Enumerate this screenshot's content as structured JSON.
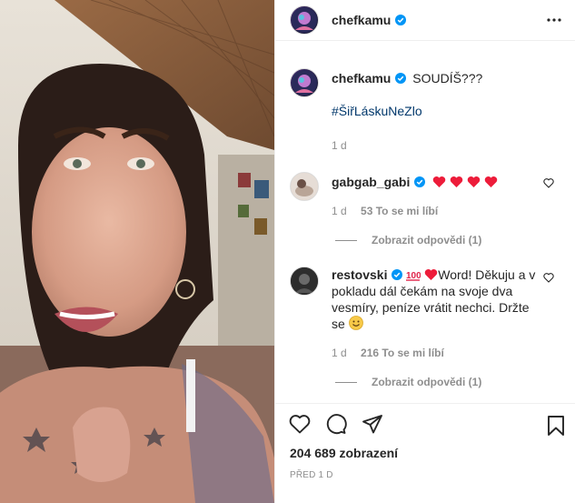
{
  "post": {
    "username": "chefkamu",
    "caption": "SOUDÍŠ???",
    "hashtag": "#ŠiřLáskuNeZlo",
    "caption_age": "1 d"
  },
  "comments": [
    {
      "username": "gabgab_gabi",
      "text": "",
      "emojis": [
        "red-heart",
        "red-heart",
        "red-heart",
        "red-heart"
      ],
      "age": "1 d",
      "likes": "53 To se mi líbí",
      "replies_label": "Zobrazit odpovědi (1)"
    },
    {
      "username": "restovski",
      "text_part1": "Word! Děkuju a v pokladu dál čekám na svoje dva vesmíry, peníze vrátit nechci. Držte se",
      "age": "1 d",
      "likes": "216 To se mi líbí",
      "replies_label": "Zobrazit odpovědi (1)"
    }
  ],
  "footer": {
    "views": "204 689 zobrazení",
    "date": "PŘED 1 D"
  },
  "icons": [
    "more-icon",
    "verified-icon",
    "like-icon",
    "comment-icon",
    "share-icon",
    "bookmark-icon"
  ],
  "colors": {
    "verified": "#0095f6",
    "heart": "#ed4956",
    "hashtag": "#00376b",
    "muted": "#8e8e8e"
  }
}
